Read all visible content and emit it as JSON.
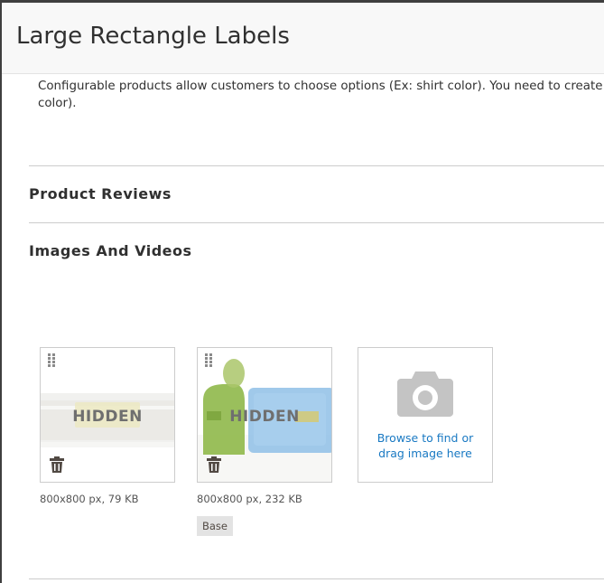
{
  "modal": {
    "title": "Large Rectangle Labels"
  },
  "configurable": {
    "description_line1": "Configurable products allow customers to choose options (Ex: shirt color). You need to create a s",
    "description_line2": "color)."
  },
  "sections": {
    "reviews_title": "Product Reviews",
    "images_title": "Images And Videos"
  },
  "images": [
    {
      "overlay": "HIDDEN",
      "meta": "800x800 px, 79 KB",
      "role": ""
    },
    {
      "overlay": "HIDDEN",
      "meta": "800x800 px, 232 KB",
      "role": "Base"
    }
  ],
  "uploader": {
    "line1": "Browse to find or",
    "line2": "drag image here",
    "icon": "camera-icon"
  },
  "colors": {
    "link": "#1979c3",
    "border": "#cccccc",
    "header_bg": "#f8f8f8",
    "badge_bg": "#e3e3e3"
  }
}
